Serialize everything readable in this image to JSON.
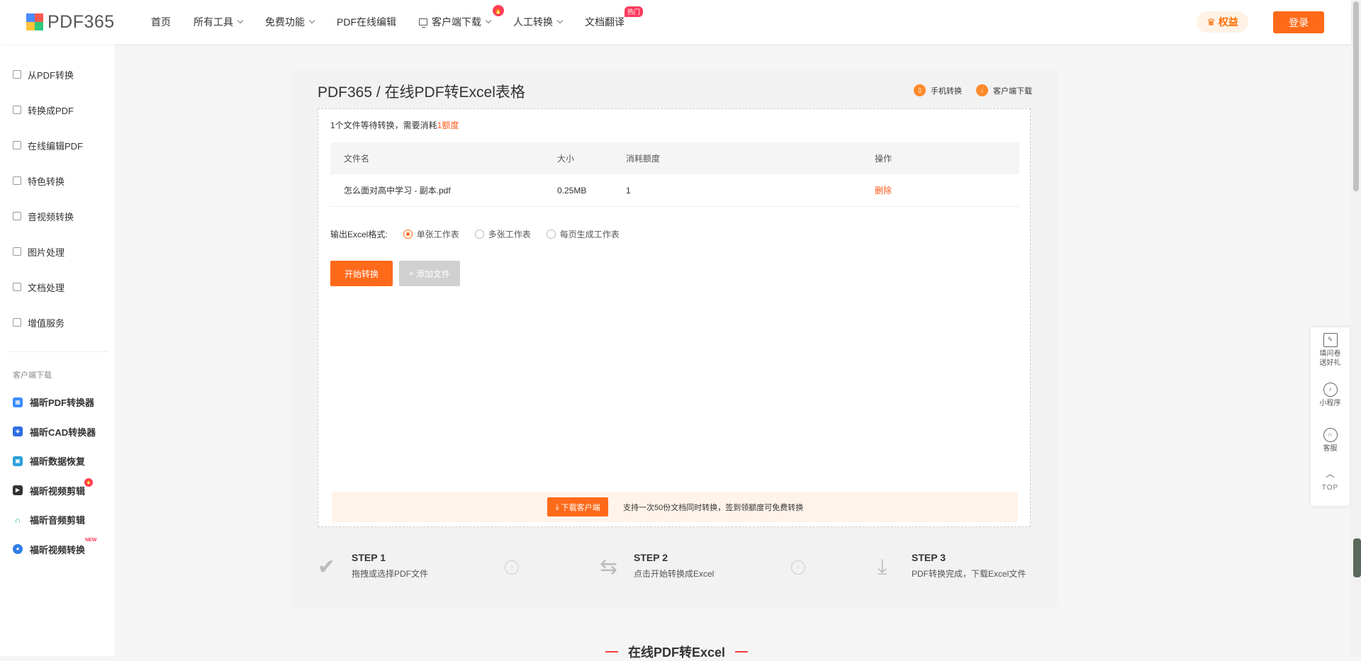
{
  "header": {
    "logo_text": "PDF365",
    "nav": [
      {
        "label": "首页"
      },
      {
        "label": "所有工具"
      },
      {
        "label": "免费功能"
      },
      {
        "label": "PDF在线编辑"
      },
      {
        "label": "客户端下载"
      },
      {
        "label": "人工转换"
      },
      {
        "label": "文档翻译",
        "badge": "热门"
      }
    ],
    "quanyi_label": "权益",
    "login_label": "登录"
  },
  "sidebar": {
    "items": [
      "从PDF转换",
      "转换成PDF",
      "在线编辑PDF",
      "特色转换",
      "音视频转换",
      "图片处理",
      "文档处理",
      "增值服务"
    ],
    "section_title": "客户端下载",
    "clients": [
      {
        "label": "福昕PDF转换器",
        "color": "#3a8cff"
      },
      {
        "label": "福昕CAD转换器",
        "color": "#2f6de0"
      },
      {
        "label": "福昕数据恢复",
        "color": "#2aa0d8"
      },
      {
        "label": "福昕视频剪辑",
        "color": "#333333"
      },
      {
        "label": "福昕音频剪辑",
        "color": "#19b36b"
      },
      {
        "label": "福昕视频转换",
        "color": "#2f7de8",
        "badge": "NEW"
      }
    ]
  },
  "main": {
    "title": "PDF365 / 在线PDF转Excel表格",
    "top_links": [
      "手机转换",
      "客户端下载"
    ],
    "file_info_prefix": "1个文件等待转换，需要消耗",
    "file_info_count": "1",
    "file_info_suffix": "额度",
    "table": {
      "headers": [
        "文件名",
        "大小",
        "消耗额度",
        "操作"
      ],
      "rows": [
        {
          "name": "怎么面对高中学习 - 副本.pdf",
          "size": "0.25MB",
          "cost": "1",
          "action": "删除"
        }
      ]
    },
    "format_label": "输出Excel格式:",
    "format_options": [
      {
        "label": "单张工作表",
        "selected": true
      },
      {
        "label": "多张工作表",
        "selected": false
      },
      {
        "label": "每页生成工作表",
        "selected": false
      }
    ],
    "start_label": "开始转换",
    "add_label": "添加文件",
    "promo": {
      "button": "下载客户端",
      "text": "支持一次50份文档同时转换，签到领额度可免费转换"
    },
    "steps": [
      {
        "title": "STEP 1",
        "desc": "拖拽或选择PDF文件"
      },
      {
        "title": "STEP 2",
        "desc": "点击开始转换成Excel"
      },
      {
        "title": "STEP 3",
        "desc": "PDF转换完成，下载Excel文件"
      }
    ],
    "bottom_title": "在线PDF转Excel"
  },
  "float_panel": {
    "items": [
      "填问卷送好礼",
      "小程序",
      "客服"
    ],
    "top_label": "TOP"
  }
}
